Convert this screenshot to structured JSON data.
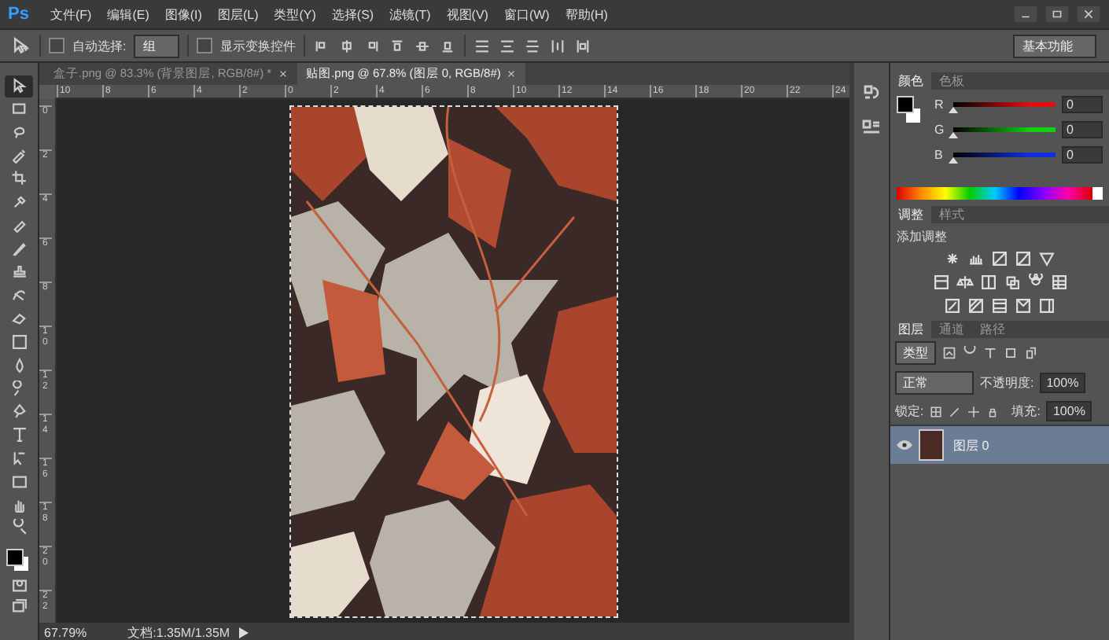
{
  "app": {
    "logo": "Ps"
  },
  "menu": [
    "文件(F)",
    "编辑(E)",
    "图像(I)",
    "图层(L)",
    "类型(Y)",
    "选择(S)",
    "滤镜(T)",
    "视图(V)",
    "窗口(W)",
    "帮助(H)"
  ],
  "options": {
    "auto_select": {
      "label": "自动选择:",
      "checked": false
    },
    "target": "组",
    "transform": {
      "label": "显示变换控件",
      "checked": false
    },
    "workspace": "基本功能"
  },
  "tabs": [
    {
      "label": "盒子.png @ 83.3% (背景图层, RGB/8#) *",
      "selected": false
    },
    {
      "label": "贴图.png @ 67.8% (图层 0, RGB/8#)",
      "selected": true
    }
  ],
  "rulers": {
    "horizontal": [
      "10",
      "8",
      "6",
      "4",
      "2",
      "0",
      "2",
      "4",
      "6",
      "8",
      "10",
      "12",
      "14",
      "16",
      "18",
      "20",
      "22",
      "24"
    ],
    "vertical": [
      "0",
      "2",
      "4",
      "6",
      "8",
      "10",
      "12",
      "14",
      "16",
      "18",
      "20",
      "22"
    ]
  },
  "tools": [
    {
      "selected": true
    },
    {
      "selected": false
    },
    {
      "selected": false
    },
    {
      "selected": false
    },
    {
      "selected": false
    },
    {
      "selected": false
    },
    {
      "selected": false
    },
    {
      "selected": false
    },
    {
      "selected": false
    },
    {
      "selected": false
    },
    {
      "selected": false
    },
    {
      "selected": false
    },
    {
      "selected": false
    },
    {
      "selected": false
    },
    {
      "selected": false
    },
    {
      "selected": false
    },
    {
      "selected": false
    },
    {
      "selected": false
    },
    {
      "selected": false
    },
    {
      "selected": false
    }
  ],
  "status_bar": {
    "zoom": "67.79%",
    "document": "文档:1.35M/1.35M"
  },
  "color_panel": {
    "tabs": [
      {
        "label": "颜色",
        "selected": true
      },
      {
        "label": "色板",
        "selected": false
      }
    ],
    "channels": [
      {
        "name": "R",
        "value": "0",
        "level": 0,
        "color": "#e01010"
      },
      {
        "name": "G",
        "value": "0",
        "level": 0,
        "color": "#10d010"
      },
      {
        "name": "B",
        "value": "0",
        "level": 0,
        "color": "#1030e0"
      }
    ]
  },
  "adjustments_panel": {
    "tabs": [
      {
        "label": "调整",
        "selected": true
      },
      {
        "label": "样式",
        "selected": false
      }
    ],
    "title": "添加调整"
  },
  "layers_panel": {
    "tabs": [
      {
        "label": "图层",
        "selected": true
      },
      {
        "label": "通道",
        "selected": false
      },
      {
        "label": "路径",
        "selected": false
      }
    ],
    "filter": "类型",
    "blend_mode": "正常",
    "opacity_label": "不透明度:",
    "opacity": "100%",
    "lock_label": "锁定:",
    "fill_label": "填充:",
    "fill": "100%",
    "layers": [
      {
        "name": "图层 0",
        "selected": true,
        "visible": true
      }
    ]
  }
}
